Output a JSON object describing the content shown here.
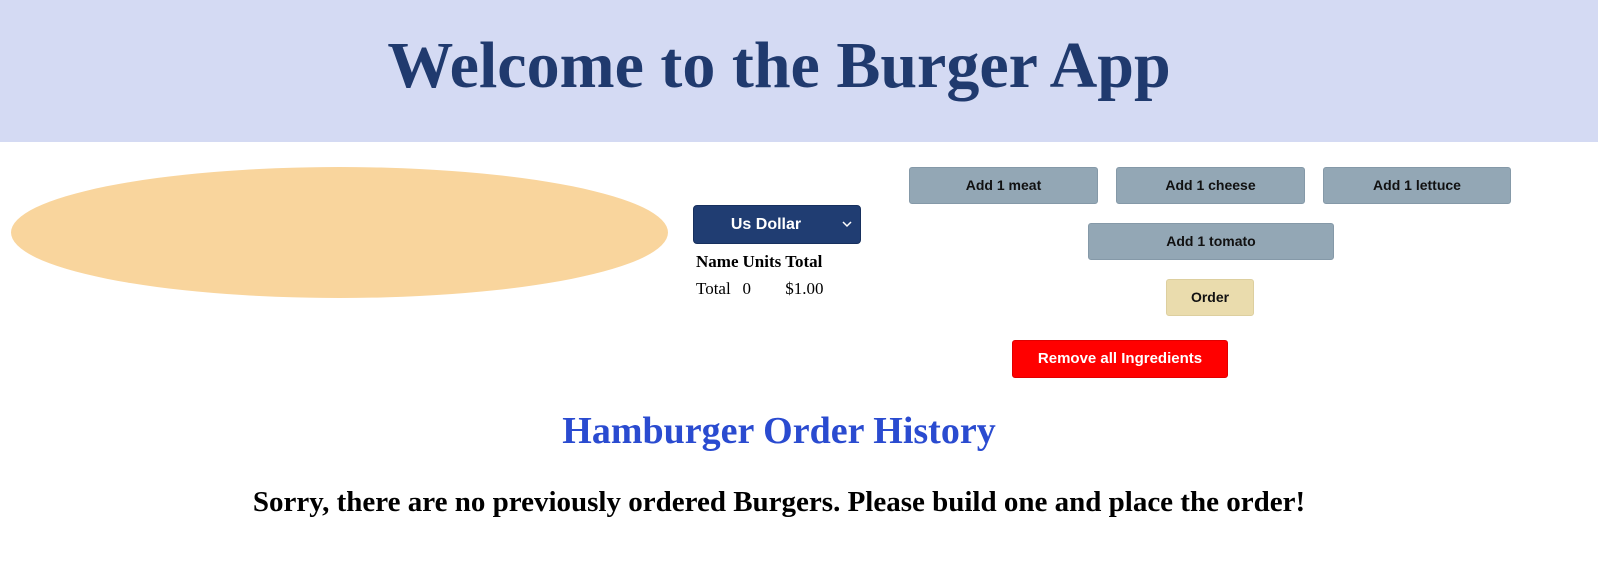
{
  "header": {
    "title": "Welcome to the Burger App"
  },
  "currency": {
    "selected": "Us Dollar"
  },
  "summary_table": {
    "headers": [
      "Name",
      "Units",
      "Total"
    ],
    "rows": [
      [
        "Total",
        "0",
        "$1.00"
      ]
    ]
  },
  "ingredients": {
    "add_meat": "Add 1 meat",
    "add_cheese": "Add 1 cheese",
    "add_lettuce": "Add 1 lettuce",
    "add_tomato": "Add 1 tomato"
  },
  "actions": {
    "order": "Order",
    "remove_all": "Remove all Ingredients"
  },
  "history": {
    "title": "Hamburger Order History",
    "empty_message": "Sorry, there are no previously ordered Burgers. Please build one and place the order!"
  },
  "colors": {
    "header_bg": "#d4daf3",
    "title": "#203a6e",
    "bun": "#f9d59d",
    "select_bg": "#203d72",
    "ingredient_button": "#93a7b5",
    "order_button": "#eadcad",
    "remove_button": "#ff0000",
    "history_title": "#2a4bd0"
  },
  "icons": {
    "currency_dropdown": "chevron-down-icon"
  }
}
